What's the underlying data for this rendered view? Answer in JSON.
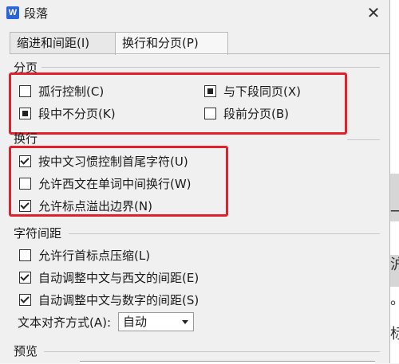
{
  "window": {
    "title": "段落",
    "app_icon_letter": "W"
  },
  "tabs": [
    {
      "label": "缩进和间距(I)",
      "active": false
    },
    {
      "label": "换行和分页(P)",
      "active": true
    }
  ],
  "sections": {
    "pagination": {
      "label": "分页",
      "items": [
        {
          "label": "孤行控制(C)",
          "state": "unchecked"
        },
        {
          "label": "与下段同页(X)",
          "state": "indeterminate"
        },
        {
          "label": "段中不分页(K)",
          "state": "indeterminate"
        },
        {
          "label": "段前分页(B)",
          "state": "unchecked"
        }
      ]
    },
    "line_break": {
      "label": "换行",
      "items": [
        {
          "label": "按中文习惯控制首尾字符(U)",
          "state": "checked"
        },
        {
          "label": "允许西文在单词中间换行(W)",
          "state": "unchecked"
        },
        {
          "label": "允许标点溢出边界(N)",
          "state": "checked"
        }
      ]
    },
    "char_spacing": {
      "label": "字符间距",
      "items": [
        {
          "label": "允许行首标点压缩(L)",
          "state": "unchecked"
        },
        {
          "label": "自动调整中文与西文的间距(E)",
          "state": "checked"
        },
        {
          "label": "自动调整中文与数字的间距(S)",
          "state": "checked"
        }
      ],
      "alignment_label": "文本对齐方式(A):",
      "alignment_value": "自动"
    },
    "preview": {
      "label": "预览"
    }
  },
  "background_doc": {
    "chars": [
      "一",
      "沪",
      "。",
      "标"
    ]
  },
  "colors": {
    "highlight": "#e0202a",
    "dialog_bg": "#f0f0f0",
    "icon_blue": "#2b63d9"
  }
}
